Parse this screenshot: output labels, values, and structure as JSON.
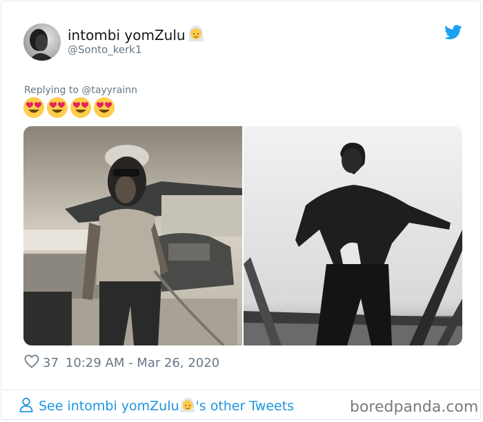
{
  "tweet": {
    "author": {
      "display_name": "intombi yomZulu",
      "handle": "@Sonto_kerk1"
    },
    "icons": {
      "twitter": "twitter-bird-icon",
      "name_emoji": "bride-with-veil-emoji",
      "like": "heart-outline-icon",
      "user": "user-icon"
    },
    "replying_to_label": "Replying to",
    "replying_to_handle": "@tayyrainn",
    "text_emojis": [
      "smiling-face-with-heart-eyes",
      "smiling-face-with-heart-eyes",
      "smiling-face-with-heart-eyes",
      "smiling-face-with-heart-eyes"
    ],
    "likes_count": "37",
    "timestamp": "10:29 AM - Mar 26, 2020",
    "media_count": 2
  },
  "footer": {
    "see_prefix": "See intombi yomZulu",
    "see_suffix": "'s other Tweets"
  },
  "watermark": "boredpanda.com",
  "colors": {
    "link_blue": "#1b95e0",
    "twitter_blue": "#1da1f2",
    "muted": "#657786",
    "border": "#e1e8ed"
  }
}
